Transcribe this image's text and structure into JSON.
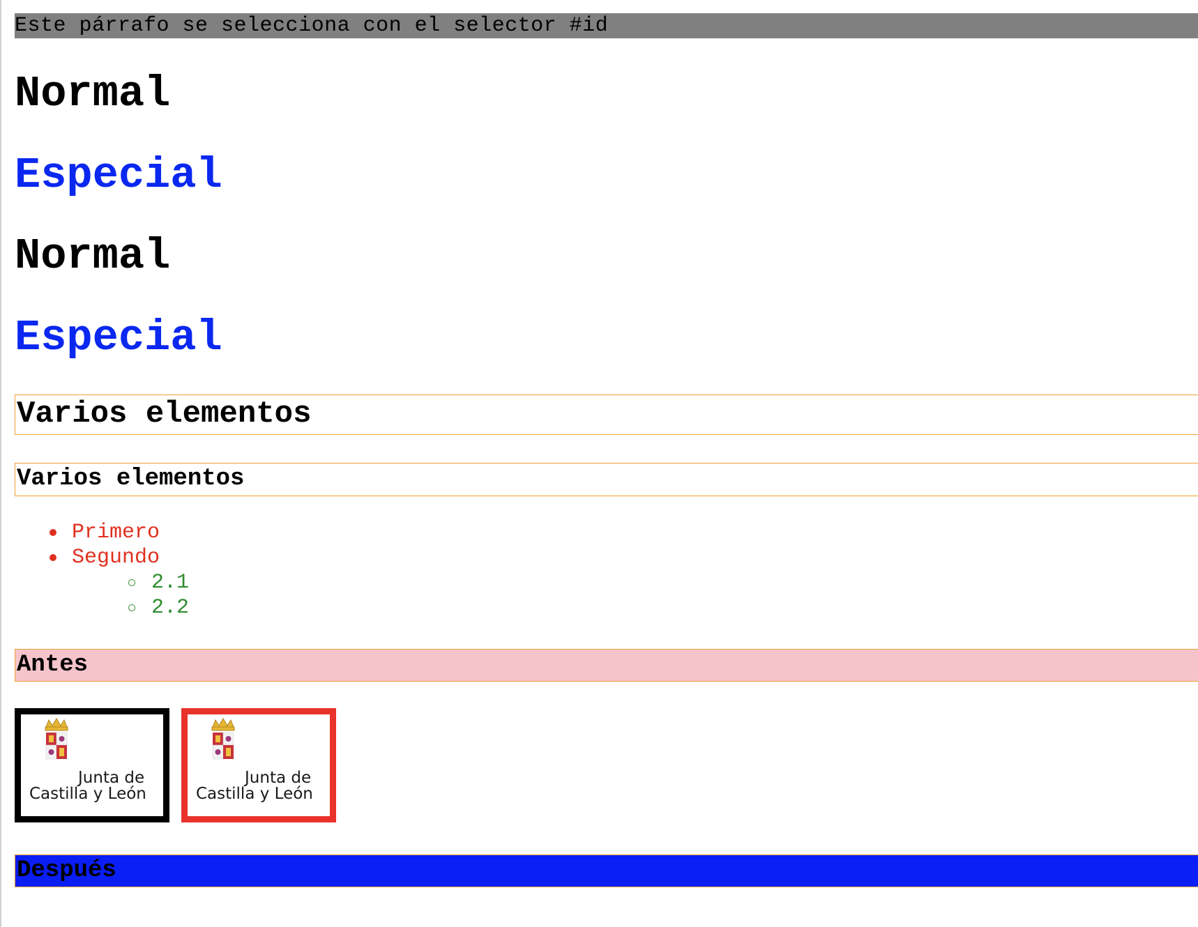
{
  "id_paragraph": "Este párrafo se selecciona con el selector #id",
  "headings": [
    {
      "text": "Normal"
    },
    {
      "text": "Especial"
    },
    {
      "text": "Normal"
    },
    {
      "text": "Especial"
    }
  ],
  "varios": {
    "h2": "Varios elementos",
    "h3": "Varios elementos"
  },
  "list": {
    "items": [
      "Primero",
      "Segundo"
    ],
    "subitems": [
      "2.1",
      "2.2"
    ]
  },
  "antes": "Antes",
  "despues": "Después",
  "logos": {
    "line1": "Junta de",
    "line2": "Castilla y León"
  },
  "colors": {
    "especial": "#0a28f0",
    "list_primary": "#e03020",
    "list_secondary": "#2e8b2e",
    "border_orange": "#f0a030",
    "antes_bg": "#f5c4cb",
    "despues_bg": "#0a1ef5",
    "id_bg": "#808080"
  }
}
